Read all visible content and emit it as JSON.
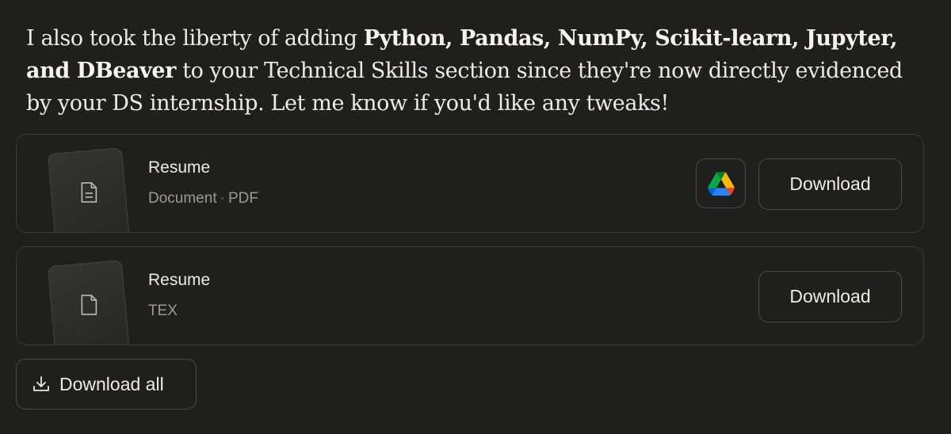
{
  "message": {
    "part1": "I also took the liberty of adding ",
    "bold1": "Python, Pandas, NumPy, Scikit-learn, Jupyter, and DBeaver",
    "part2": " to your Technical Skills section since they're now directly evidenced by your DS internship. Let me know if you'd like any tweaks!"
  },
  "files": [
    {
      "title": "Resume",
      "type": "Document",
      "separator": "·",
      "format": "PDF",
      "icon": "document-lines-icon",
      "download_label": "Download",
      "drive_icon": "google-drive-icon"
    },
    {
      "title": "Resume",
      "format": "TEX",
      "icon": "blank-file-icon",
      "download_label": "Download"
    }
  ],
  "download_all": {
    "label": "Download all",
    "icon": "download-icon"
  },
  "colors": {
    "background": "#1f1f1e",
    "border": "#3a3a38",
    "text": "#ecebe6",
    "muted": "#9c9a94",
    "drive_green": "#0f9d58",
    "drive_yellow": "#f4b400",
    "drive_blue": "#4285f4"
  }
}
